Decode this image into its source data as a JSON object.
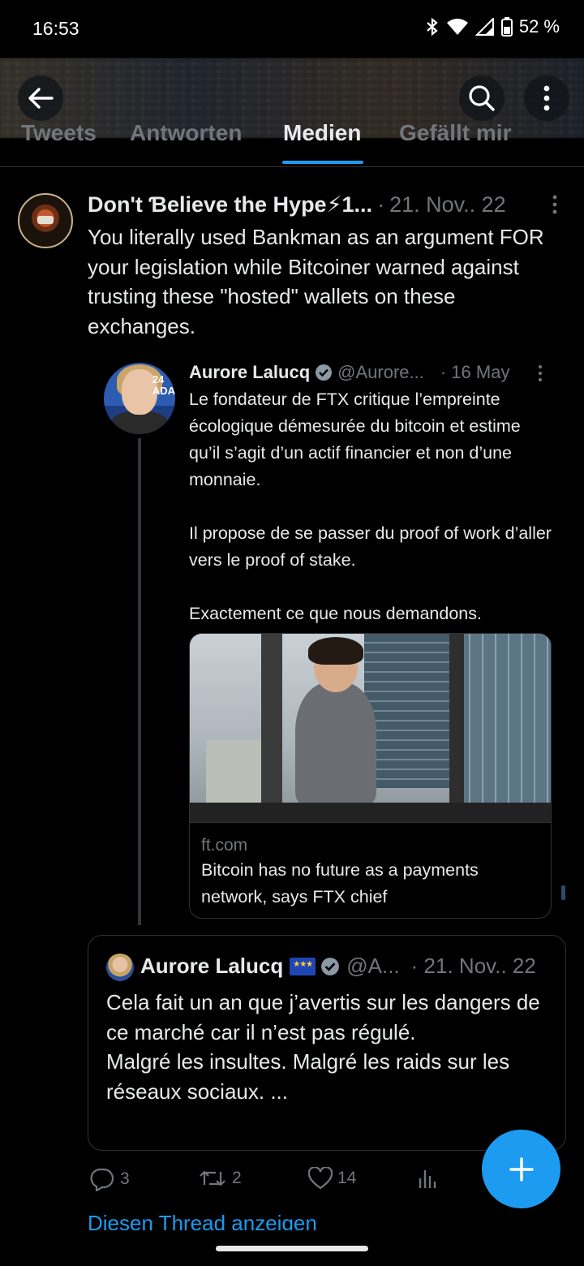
{
  "status_bar": {
    "time": "16:53",
    "battery": "52 %"
  },
  "header": {
    "back_icon": "arrow-left-icon",
    "search_icon": "search-icon",
    "more_icon": "more-vertical-icon"
  },
  "tabs": [
    {
      "label": "Tweets"
    },
    {
      "label": "Antworten"
    },
    {
      "label": "Medien",
      "active": true
    },
    {
      "label": "Gefällt mir"
    }
  ],
  "tweet": {
    "author_name": "Don't Ɓelieve the Hype⚡1...",
    "date": "21. Nov.. 22",
    "text": "You literally used Bankman as an argument FOR your legislation while  Bitcoiner warned against trusting these \"hosted\" wallets on these exchanges."
  },
  "parent_tweet": {
    "author_name": "Aurore Lalucq",
    "handle": "@Aurore...",
    "date": "16 May",
    "avatar_badge": "24\nADA",
    "text": "Le fondateur de FTX critique l’empreinte écologique démesurée du bitcoin et estime qu’il s’agit d’un actif financier et non d’une monnaie.\n\nIl propose de se passer du proof of work d’aller vers le proof of stake.\n\nExactement ce que nous demandons.",
    "card": {
      "domain": "ft.com",
      "title": "Bitcoin has no future as a payments network, says FTX chief"
    }
  },
  "quoted_tweet": {
    "author_name": "Aurore Lalucq",
    "handle": "@A...",
    "date": "21. Nov.. 22",
    "text": "Cela fait un an que j’avertis sur les dangers de ce marché car il n’est pas régulé.\nMalgré les insultes. Malgré les raids sur les réseaux sociaux. ..."
  },
  "actions": {
    "replies": "3",
    "retweets": "2",
    "likes": "14"
  },
  "show_thread": "Diesen Thread anzeigen",
  "colors": {
    "accent": "#1d9bf0",
    "background": "#000000",
    "muted": "#71767b"
  }
}
